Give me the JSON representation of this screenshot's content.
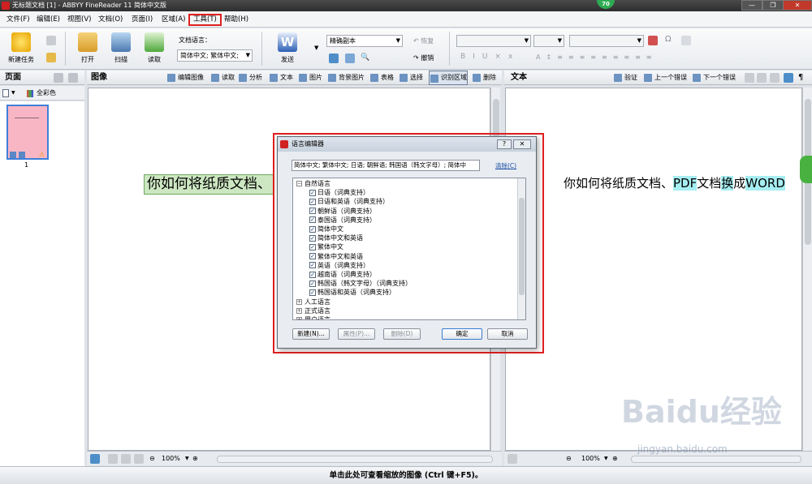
{
  "app": {
    "title": "无标题文档 [1] - ABBYY FineReader 11 简体中文版",
    "badge": "70",
    "win_min": "—",
    "win_max": "❐",
    "win_close": "✕"
  },
  "menu": [
    "文件(F)",
    "编辑(E)",
    "视图(V)",
    "文档(O)",
    "页面(I)",
    "区域(A)",
    "工具(T)",
    "帮助(H)"
  ],
  "toolbar": {
    "new_task": "新建任务",
    "open": "打开",
    "scan": "扫描",
    "read": "读取",
    "doc_lang_label": "文档语言：",
    "doc_lang_value": "简体中文; 繁体中文;",
    "send": "发送",
    "mode_value": "精确副本",
    "undo": "恢复",
    "redo": "撤销"
  },
  "pages_pane": {
    "title": "页面",
    "color_mode": "全彩色",
    "page_number": "1"
  },
  "image_pane": {
    "title": "图像",
    "tools": [
      "编辑图像",
      "读取",
      "分析",
      "文本",
      "图片",
      "背景图片",
      "表格",
      "选择",
      "识别区域",
      "删除"
    ],
    "text_block": "你如何将纸质文档、",
    "zoom": "100%"
  },
  "text_pane": {
    "title": "文本",
    "tools": [
      "验证",
      "上一个错误",
      "下一个错误"
    ],
    "content_parts": [
      "你如何将纸质文档、",
      "PDF",
      "文档",
      "换",
      "成",
      "WORD"
    ],
    "zoom": "100%"
  },
  "dialog": {
    "title": "语言编辑器",
    "selected_languages": "简体中文; 繁体中文; 日语; 朝鲜语; 韩国语（韩文字母）; 简体中",
    "clear_link": "清除(C)",
    "tree_root": "自然语言",
    "languages": [
      "日语（词典支持）",
      "日语和英语（词典支持）",
      "朝鲜语（词典支持）",
      "泰国语（词典支持）",
      "简体中文",
      "简体中文和英语",
      "繁体中文",
      "繁体中文和英语",
      "英语（词典支持）",
      "越南语（词典支持）",
      "韩国语（韩文字母）（词典支持）",
      "韩国语和英语（词典支持）"
    ],
    "other_groups": [
      "人工语言",
      "正式语言",
      "用户语言"
    ],
    "buttons": {
      "new": "新建(N)...",
      "props": "属性(P)...",
      "delete": "删除(D)",
      "ok": "确定",
      "cancel": "取消"
    }
  },
  "bottom_status": "单击此处可查看缩放的图像 (Ctrl 键+F5)。",
  "watermark": {
    "brand": "Baidu经验",
    "url": "jingyan.baidu.com"
  }
}
